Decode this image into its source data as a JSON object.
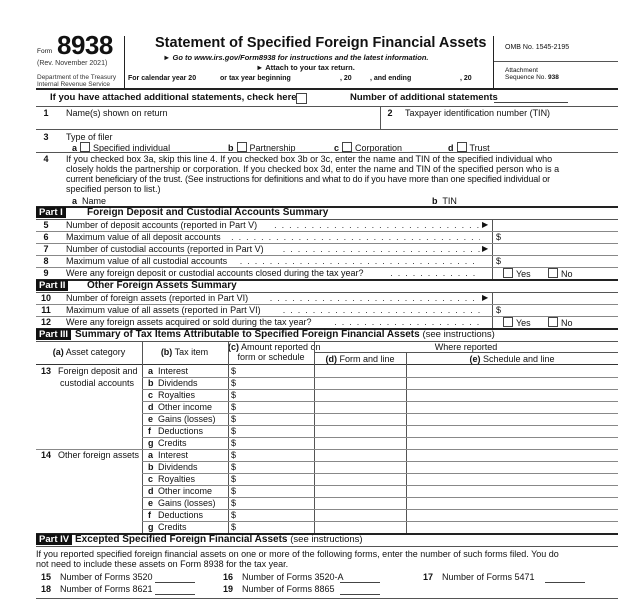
{
  "header": {
    "form_label": "Form",
    "form_number": "8938",
    "revision": "(Rev. November 2021)",
    "department": "Department of the Treasury",
    "service": "Internal Revenue Service",
    "title": "Statement of Specified Foreign Financial Assets",
    "goto_line": "► Go to www.irs.gov/Form8938 for instructions and the latest information.",
    "attach_line": "► Attach to your tax return.",
    "calendar_year": "For calendar year 20",
    "tax_year_beginning": "or tax year beginning",
    "comma_20_a": ", 20",
    "and_ending": ", and ending",
    "comma_20_b": ", 20",
    "omb": "OMB No. 1545-2195",
    "attachment": "Attachment",
    "sequence_label": "Sequence No.",
    "sequence_no": "938"
  },
  "attached": {
    "check_label": "If you have attached additional statements, check here",
    "number_label": "Number of additional statements"
  },
  "line1": {
    "num": "1",
    "label": "Name(s) shown on return"
  },
  "line2": {
    "num": "2",
    "label": "Taxpayer identification number (TIN)"
  },
  "line3": {
    "num": "3",
    "label": "Type of filer",
    "options": [
      {
        "letter": "a",
        "label": "Specified individual"
      },
      {
        "letter": "b",
        "label": "Partnership"
      },
      {
        "letter": "c",
        "label": "Corporation"
      },
      {
        "letter": "d",
        "label": "Trust"
      }
    ]
  },
  "line4": {
    "num": "4",
    "text_lines": [
      "If you checked box 3a, skip this line 4. If you checked box 3b or 3c, enter the name and TIN of the specified individual who",
      "closely holds the partnership or corporation. If you checked box 3d, enter the name and TIN of the specified person who is a",
      "current beneficiary of the trust. (See instructions for definitions and what to do if you have more than one specified individual or",
      "specified person to list.)"
    ],
    "a_letter": "a",
    "a_label": "Name",
    "b_letter": "b",
    "b_label": "TIN"
  },
  "part1": {
    "tag": "Part I",
    "title": "Foreign Deposit and Custodial Accounts Summary",
    "lines": [
      {
        "num": "5",
        "label": "Number of deposit accounts (reported in Part V)",
        "suffix": "arrow"
      },
      {
        "num": "6",
        "label": "Maximum value of all deposit accounts",
        "suffix": "$"
      },
      {
        "num": "7",
        "label": "Number of custodial accounts (reported in Part V)",
        "suffix": "arrow"
      },
      {
        "num": "8",
        "label": "Maximum value of all custodial accounts",
        "suffix": "$"
      },
      {
        "num": "9",
        "label": "Were any foreign deposit or custodial accounts closed during the tax year?",
        "suffix": "yesno"
      }
    ]
  },
  "part2": {
    "tag": "Part II",
    "title": "Other Foreign Assets Summary",
    "lines": [
      {
        "num": "10",
        "label": "Number of foreign assets (reported in Part VI)",
        "suffix": "arrow"
      },
      {
        "num": "11",
        "label": "Maximum value of all assets (reported in Part VI)",
        "suffix": "$"
      },
      {
        "num": "12",
        "label": "Were any foreign assets acquired or sold during the tax year?",
        "suffix": "yesno"
      }
    ]
  },
  "yes": "Yes",
  "no": "No",
  "dollar": "$",
  "part3": {
    "tag": "Part III",
    "title": "Summary of Tax Items Attributable to Specified Foreign Financial Assets",
    "title_note": "(see instructions)",
    "col_a": {
      "letter": "(a)",
      "label": "Asset category"
    },
    "col_b": {
      "letter": "(b)",
      "label": "Tax item"
    },
    "col_c": {
      "letter": "(c)",
      "label": "Amount reported on",
      "label2": "form or schedule"
    },
    "where_reported": "Where reported",
    "col_d": {
      "letter": "(d)",
      "label": "Form and line"
    },
    "col_e": {
      "letter": "(e)",
      "label": "Schedule and line"
    },
    "groups": [
      {
        "num": "13",
        "label_lines": [
          "Foreign deposit and",
          "custodial accounts"
        ]
      },
      {
        "num": "14",
        "label_lines": [
          "Other foreign assets"
        ]
      }
    ],
    "items": [
      {
        "letter": "a",
        "label": "Interest"
      },
      {
        "letter": "b",
        "label": "Dividends"
      },
      {
        "letter": "c",
        "label": "Royalties"
      },
      {
        "letter": "d",
        "label": "Other income"
      },
      {
        "letter": "e",
        "label": "Gains (losses)"
      },
      {
        "letter": "f",
        "label": "Deductions"
      },
      {
        "letter": "g",
        "label": "Credits"
      }
    ]
  },
  "part4": {
    "tag": "Part IV",
    "title": "Excepted Specified Foreign Financial Assets",
    "title_note": "(see instructions)",
    "intro_lines": [
      "If you reported specified foreign financial assets on one or more of the following forms, enter the number of such forms filed. You do",
      "not need to include these assets on Form 8938 for the tax year."
    ],
    "lines": [
      {
        "num": "15",
        "label": "Number of Forms 3520"
      },
      {
        "num": "16",
        "label": "Number of Forms 3520-A"
      },
      {
        "num": "17",
        "label": "Number of Forms 5471"
      },
      {
        "num": "18",
        "label": "Number of Forms 8621"
      },
      {
        "num": "19",
        "label": "Number of Forms 8865"
      }
    ]
  }
}
